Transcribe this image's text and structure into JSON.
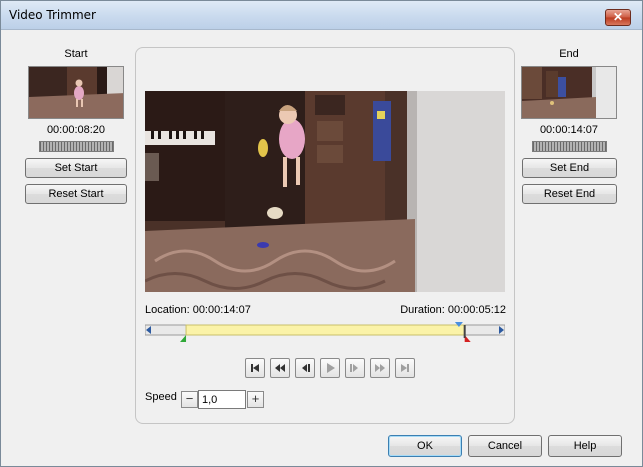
{
  "window": {
    "title": "Video Trimmer"
  },
  "start": {
    "label": "Start",
    "timecode": "00:00:08:20",
    "set_label": "Set Start",
    "reset_label": "Reset Start"
  },
  "end": {
    "label": "End",
    "timecode": "00:00:14:07",
    "set_label": "Set End",
    "reset_label": "Reset End"
  },
  "player": {
    "location": "Location: 00:00:14:07",
    "duration": "Duration: 00:00:05:12",
    "trim_start_fraction": 0.114,
    "trim_end_fraction": 0.888,
    "playhead_fraction": 0.872
  },
  "speed": {
    "label": "Speed",
    "value": "1,0"
  },
  "footer": {
    "ok_label": "OK",
    "cancel_label": "Cancel",
    "help_label": "Help"
  },
  "colors": {
    "trim_region": "#fbf3a8",
    "start_marker": "#2fa838",
    "end_marker": "#d42020",
    "playhead": "#4a8fe0"
  }
}
